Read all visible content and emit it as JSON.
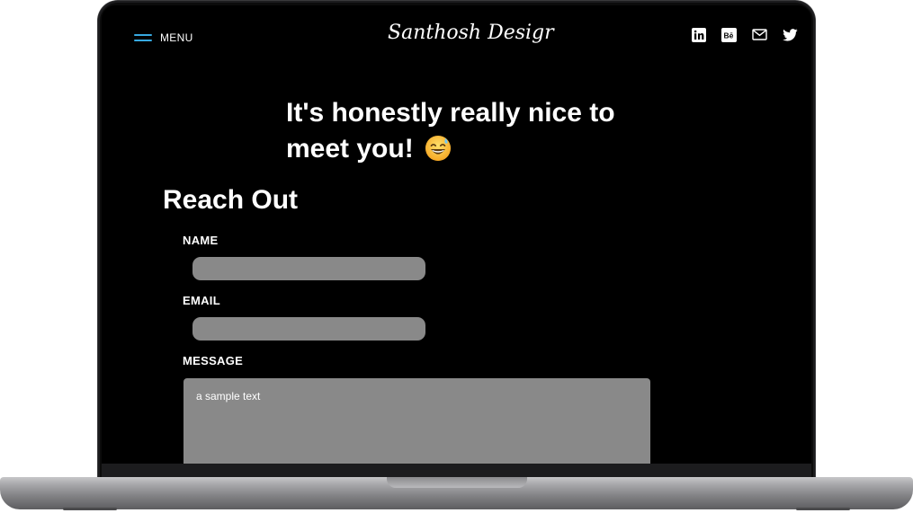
{
  "header": {
    "menu_label": "MENU",
    "logo_text": "Santhosh Desigr",
    "menu_icon": "hamburger-icon",
    "accent_color": "#37a9e1",
    "social_links": [
      {
        "name": "linkedin",
        "icon": "linkedin-icon"
      },
      {
        "name": "behance",
        "icon": "behance-icon"
      },
      {
        "name": "email",
        "icon": "mail-icon"
      },
      {
        "name": "twitter",
        "icon": "twitter-icon"
      }
    ]
  },
  "hero": {
    "headline_line1": "It's honestly really nice to",
    "headline_line2": "meet you!",
    "emoji": "grinning-face-with-sweat-emoji"
  },
  "contact": {
    "section_title": "Reach Out",
    "name_label": "NAME",
    "name_value": "",
    "email_label": "EMAIL",
    "email_value": "",
    "message_label": "MESSAGE",
    "message_value": "a sample text",
    "input_color": "#898989"
  },
  "theme": {
    "background": "#000000",
    "text": "#ffffff"
  }
}
